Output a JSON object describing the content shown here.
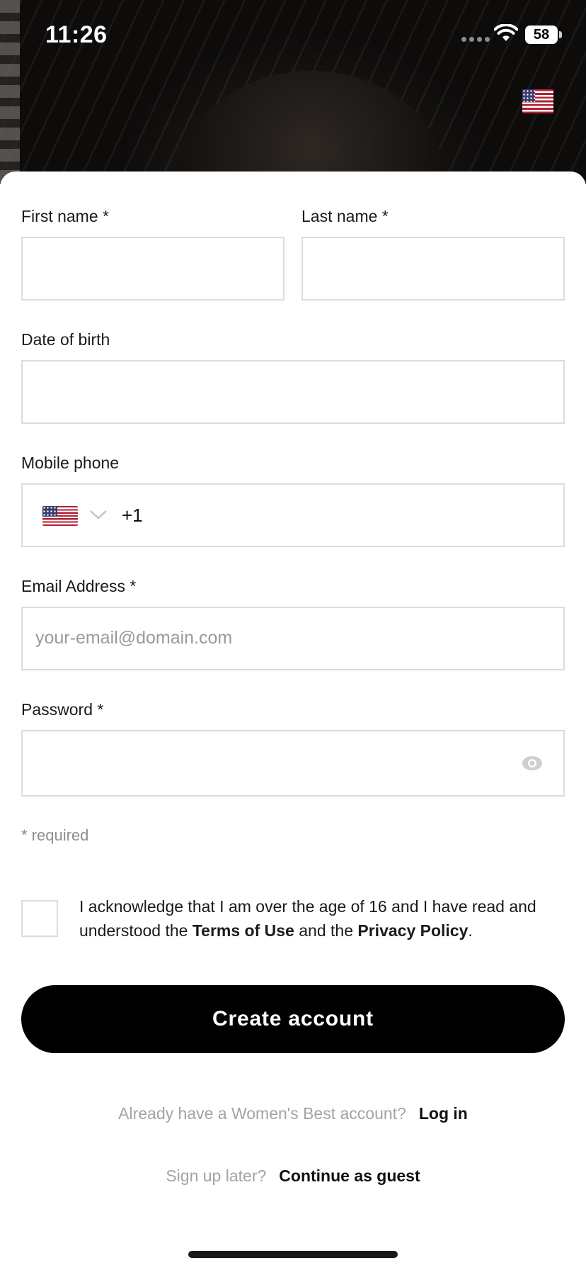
{
  "status_bar": {
    "time": "11:26",
    "battery": "58"
  },
  "form": {
    "first_name_label": "First name *",
    "last_name_label": "Last name *",
    "dob_label": "Date of birth",
    "phone_label": "Mobile phone",
    "phone_dial_code": "+1",
    "email_label": "Email Address *",
    "email_placeholder": "your-email@domain.com",
    "password_label": "Password *",
    "required_note": "* required"
  },
  "consent": {
    "prefix": "I acknowledge that I am over the age of 16 and I have read and understood the ",
    "terms_link": "Terms of Use",
    "middle": " and the ",
    "privacy_link": "Privacy Policy",
    "suffix": "."
  },
  "actions": {
    "create_account": "Create account",
    "login_prompt": "Already have a Women's Best account?",
    "login_link": "Log in",
    "guest_prompt": "Sign up later?",
    "guest_link": "Continue as guest"
  },
  "colors": {
    "cta_bg": "#000000",
    "field_border": "#dcdcdc",
    "muted_text": "#a3a3a3"
  }
}
